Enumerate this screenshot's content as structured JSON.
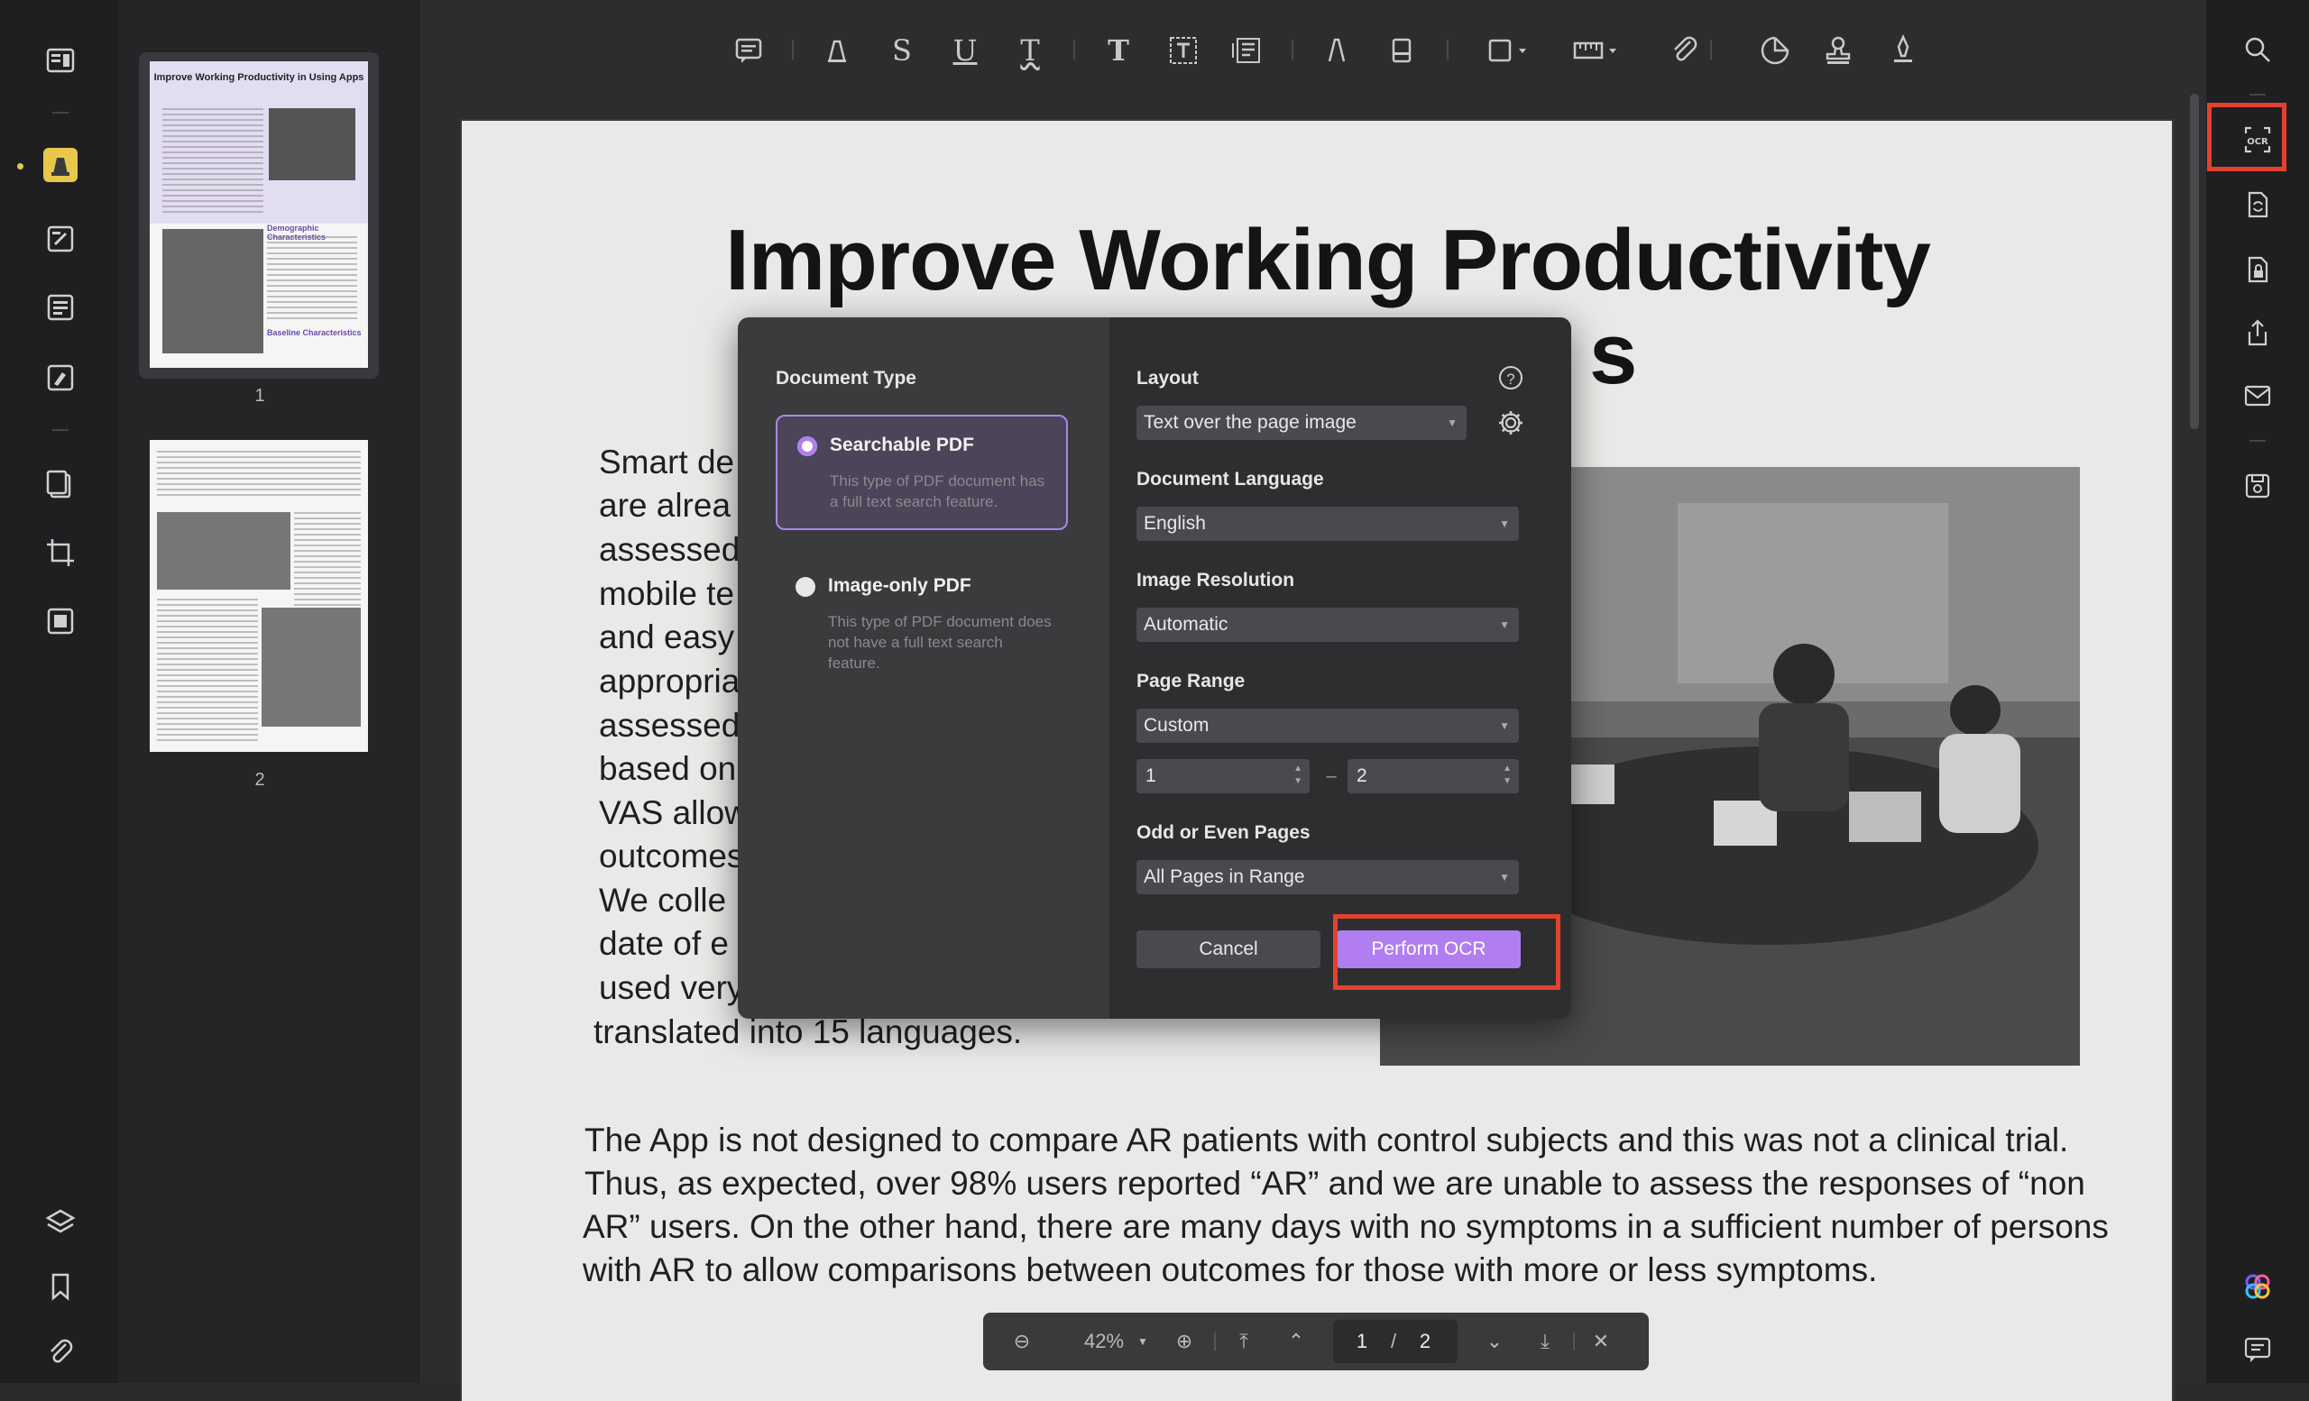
{
  "window": {
    "title": ""
  },
  "toolbar": {
    "tools": [
      "comment-icon",
      "highlight-icon",
      "strikethrough-icon",
      "underline-icon",
      "squiggly-icon",
      "text-icon",
      "textbox-icon",
      "text-callout-icon",
      "pencil-icon",
      "eraser-icon",
      "shape-icon",
      "measure-icon",
      "attachment-icon",
      "sticker-icon",
      "stamp-icon",
      "signature-icon"
    ]
  },
  "thumbnails": {
    "pages": [
      {
        "label": "1",
        "title": "Improve Working Productivity in Using Apps",
        "subhead1": "Demographic Characteristics",
        "subhead2": "Baseline Characteristics"
      },
      {
        "label": "2"
      }
    ]
  },
  "document": {
    "title_line1": "Improve Working Productivity",
    "title_line2_fragment": "s",
    "col_lines": [
      "Smart de",
      "are alrea",
      "assessed",
      "mobile te",
      "and easy",
      "appropria",
      "assessed",
      "based on",
      "VAS allow",
      "outcomes",
      "We colle",
      "date of e",
      "used very"
    ],
    "translated_line": "translated into 15 languages.",
    "para2": [
      "The App is not designed to compare AR patients with control subjects and this was not a clinical trial.",
      "Thus, as expected, over 98% users reported “AR” and we are unable to assess the responses of “non",
      "AR” users. On the other hand, there are many days with no symptoms in a sufficient number of persons",
      "with AR to allow comparisons between outcomes for those with more or less symptoms."
    ]
  },
  "dialog": {
    "doc_type_title": "Document Type",
    "options": [
      {
        "label": "Searchable PDF",
        "desc": "This type of PDF document has a full text search feature.",
        "selected": true
      },
      {
        "label": "Image-only PDF",
        "desc": "This type of PDF document does not have a full text search feature.",
        "selected": false
      }
    ],
    "layout_label": "Layout",
    "layout_value": "Text over the page image",
    "language_label": "Document Language",
    "language_value": "English",
    "resolution_label": "Image Resolution",
    "resolution_value": "Automatic",
    "range_label": "Page Range",
    "range_value": "Custom",
    "range_from": "1",
    "range_to": "2",
    "range_dash": "–",
    "oddeven_label": "Odd or Even Pages",
    "oddeven_value": "All Pages in Range",
    "cancel": "Cancel",
    "perform": "Perform OCR"
  },
  "zoombar": {
    "zoom": "42%",
    "current_page": "1",
    "separator": "/",
    "total_pages": "2"
  },
  "colors": {
    "accent": "#b07ef0",
    "highlight_box": "#e2422d",
    "tool_active": "#e8c84a"
  }
}
